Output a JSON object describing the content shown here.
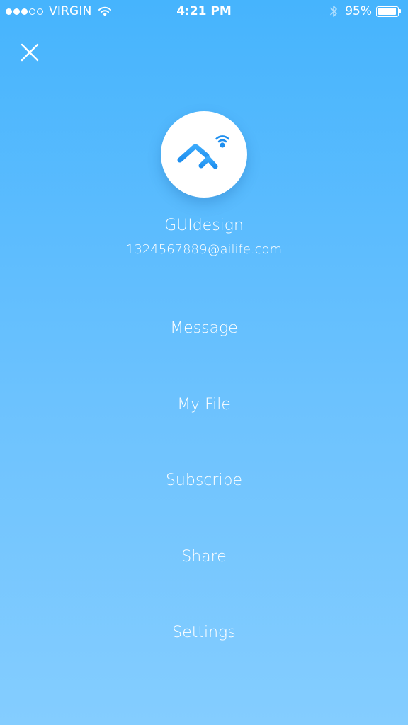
{
  "status_bar": {
    "carrier": "VIRGIN",
    "time": "4:21 PM",
    "battery": "95%",
    "signal_strength": 3,
    "signal_total": 5
  },
  "profile": {
    "name": "GUIdesign",
    "email": "1324567889@ailife.com"
  },
  "menu": {
    "items": [
      {
        "label": "Message"
      },
      {
        "label": "My File"
      },
      {
        "label": "Subscribe"
      },
      {
        "label": "Share"
      },
      {
        "label": "Settings"
      }
    ]
  },
  "icons": {
    "close": "close-icon",
    "logo": "app-logo-icon",
    "wifi": "wifi-icon",
    "bluetooth": "bluetooth-icon",
    "battery": "battery-icon"
  },
  "colors": {
    "gradient_top": "#46b4fd",
    "gradient_bottom": "#84cdff",
    "logo_blue": "#2a9bf5",
    "text": "#ffffff"
  }
}
